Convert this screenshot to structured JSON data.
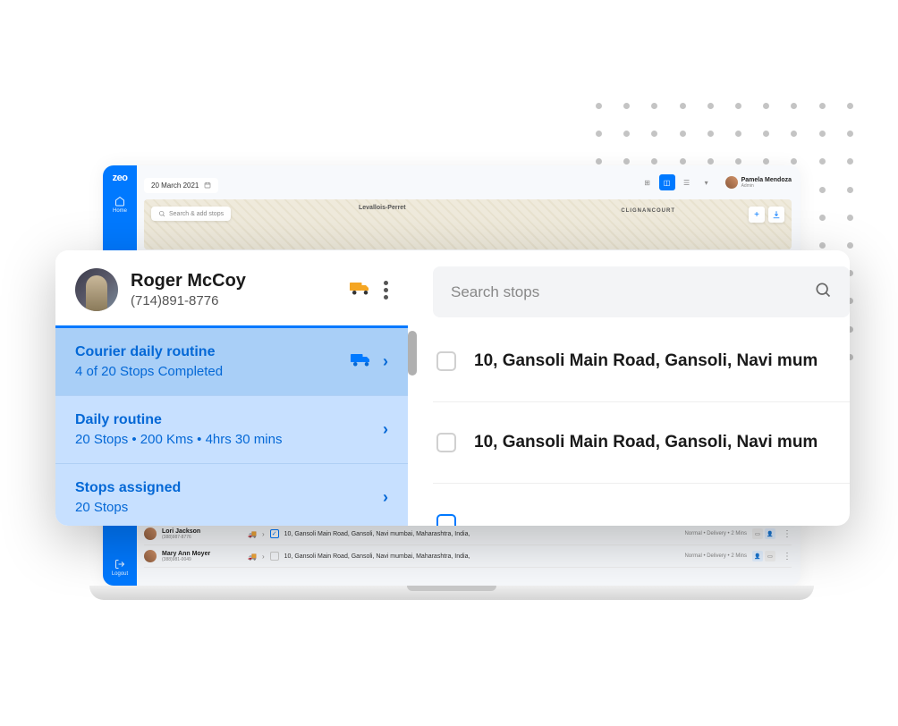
{
  "back": {
    "logo": "zeo",
    "nav_home": "Home",
    "nav_logout": "Logout",
    "date": "20 March 2021",
    "user_name": "Pamela Mendoza",
    "user_role": "Admin",
    "map_label1": "Levallois-Perret",
    "map_label2": "CLIGNANCOURT",
    "search_placeholder": "Search & add stops",
    "list": [
      {
        "name": "Lori Jackson",
        "phone": "(388)987-8776",
        "address": "10, Gansoli Main Road, Gansoli, Navi mumbai, Maharashtra, India,",
        "meta": "Normal • Delivery • 2 Mins"
      },
      {
        "name": "Mary Ann Moyer",
        "phone": "(388)981-0049",
        "address": "10, Gansoli Main Road, Gansoli, Navi mumbai, Maharashtra, India,",
        "meta": "Normal • Delivery • 2 Mins"
      }
    ]
  },
  "fg": {
    "driver_name": "Roger McCoy",
    "driver_phone": "(714)891-8776",
    "routes": [
      {
        "title": "Courier daily routine",
        "sub": "4 of 20 Stops Completed",
        "selected": true,
        "icon": true
      },
      {
        "title": "Daily routine",
        "sub": "20 Stops • 200 Kms • 4hrs 30 mins",
        "selected": false,
        "icon": false
      },
      {
        "title": "Stops assigned",
        "sub": "20 Stops",
        "selected": false,
        "icon": false
      }
    ],
    "search_placeholder": "Search stops",
    "stops": [
      {
        "address": "10, Gansoli Main Road, Gansoli, Navi mum",
        "checked": false
      },
      {
        "address": "10, Gansoli Main Road, Gansoli, Navi mum",
        "checked": false
      }
    ]
  }
}
